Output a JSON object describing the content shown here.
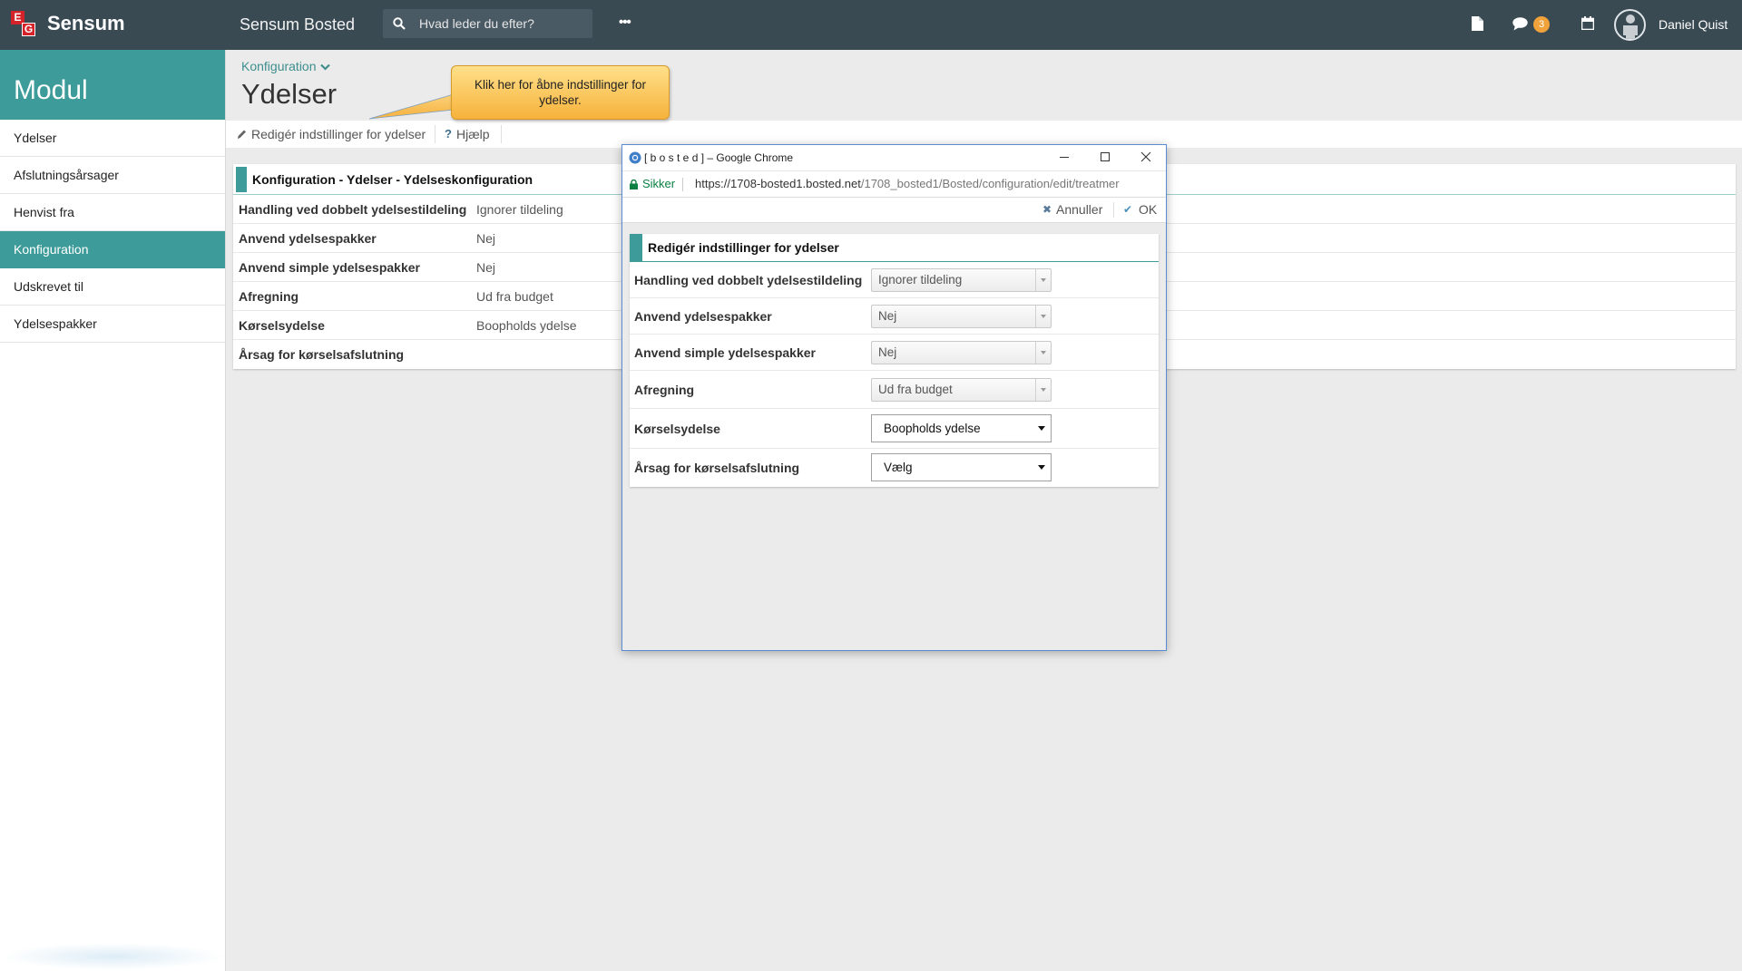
{
  "app": {
    "logo_mark_top": "E",
    "logo_mark_bottom": "G",
    "logo_text": "Sensum",
    "product_title": "Sensum Bosted"
  },
  "search": {
    "placeholder": "Hvad leder du efter?",
    "icon": "search-icon"
  },
  "topbar": {
    "more_label": "•••",
    "icons": [
      "document-icon",
      "chat-icon",
      "calendar-icon",
      "avatar-icon"
    ],
    "chat_badge": "3",
    "user_name": "Daniel Quist"
  },
  "sidebar": {
    "title": "Modul",
    "items": [
      {
        "label": "Ydelser"
      },
      {
        "label": "Afslutningsårsager"
      },
      {
        "label": "Henvist fra"
      },
      {
        "label": "Konfiguration",
        "active": true
      },
      {
        "label": "Udskrevet til"
      },
      {
        "label": "Ydelsespakker"
      }
    ]
  },
  "page": {
    "breadcrumb": "Konfiguration",
    "title": "Ydelser"
  },
  "toolbar": {
    "edit_label": "Redigér indstillinger for ydelser",
    "help_label": "Hjælp"
  },
  "tooltip": {
    "text": "Klik her for åbne indstillinger for ydelser."
  },
  "config_panel": {
    "title": "Konfiguration - Ydelser - Ydelseskonfiguration",
    "rows": [
      {
        "label": "Handling ved dobbelt ydelsestildeling",
        "value": "Ignorer tildeling"
      },
      {
        "label": "Anvend ydelsespakker",
        "value": "Nej"
      },
      {
        "label": "Anvend simple ydelsespakker",
        "value": "Nej"
      },
      {
        "label": "Afregning",
        "value": "Ud fra budget"
      },
      {
        "label": "Kørselsydelse",
        "value": "Boopholds ydelse"
      },
      {
        "label": "Årsag for kørselsafslutning",
        "value": ""
      }
    ]
  },
  "popup": {
    "window_title": "[ b o s t e d ] – Google Chrome",
    "secure_label": "Sikker",
    "url_host": "https://1708-bosted1.bosted.net",
    "url_path": "/1708_bosted1/Bosted/configuration/edit/treatmer",
    "cancel_label": "Annuller",
    "ok_label": "OK",
    "form_title": "Redigér indstillinger for ydelser",
    "fields": [
      {
        "label": "Handling ved dobbelt ydelsestildeling",
        "value": "Ignorer tildeling"
      },
      {
        "label": "Anvend ydelsespakker",
        "value": "Nej"
      },
      {
        "label": "Anvend simple ydelsespakker",
        "value": "Nej"
      },
      {
        "label": "Afregning",
        "value": "Ud fra budget"
      },
      {
        "label": "Kørselsydelse",
        "value": "Boopholds ydelse"
      },
      {
        "label": "Årsag for kørselsafslutning",
        "value": "Vælg"
      }
    ]
  },
  "colors": {
    "topbar": "#394a53",
    "accent": "#3d9c9a",
    "tooltip": "#f7b23b",
    "secure": "#0b8043",
    "badge": "#f2a23a"
  }
}
